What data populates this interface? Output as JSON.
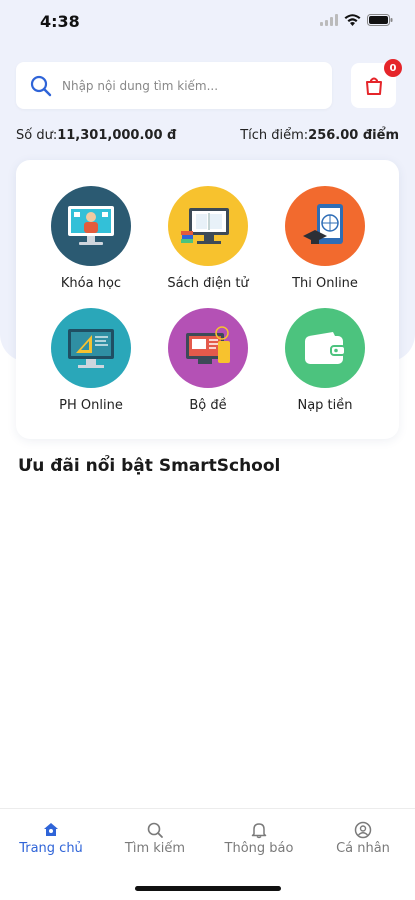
{
  "status": {
    "time": "4:38"
  },
  "search": {
    "placeholder": "Nhập nội dung tìm kiếm..."
  },
  "cart": {
    "badge": "0"
  },
  "balance": {
    "balance_label": "Số dư:",
    "balance_value": "11,301,000.00 đ",
    "points_label": "Tích điểm:",
    "points_value": "256.00 điểm"
  },
  "menu": {
    "items": [
      {
        "label": "Khóa học",
        "icon": "courses-icon",
        "color": "#2b5a72"
      },
      {
        "label": "Sách điện tử",
        "icon": "ebook-icon",
        "color": "#f7c22e"
      },
      {
        "label": "Thi Online",
        "icon": "online-exam-icon",
        "color": "#f26a2e"
      },
      {
        "label": "PH Online",
        "icon": "parent-online-icon",
        "color": "#2aa7b9"
      },
      {
        "label": "Bộ đề",
        "icon": "exam-set-icon",
        "color": "#b451b5"
      },
      {
        "label": "Nạp tiền",
        "icon": "wallet-icon",
        "color": "#4cc37e"
      }
    ]
  },
  "section": {
    "title": "Ưu đãi nổi bật SmartSchool"
  },
  "nav": {
    "items": [
      {
        "label": "Trang chủ",
        "icon": "home-icon",
        "active": true
      },
      {
        "label": "Tìm kiếm",
        "icon": "search-icon",
        "active": false
      },
      {
        "label": "Thông báo",
        "icon": "bell-icon",
        "active": false
      },
      {
        "label": "Cá nhân",
        "icon": "user-icon",
        "active": false
      }
    ]
  },
  "colors": {
    "accent": "#2f64d8",
    "badge": "#e5252a",
    "background": "#eef1fb"
  }
}
